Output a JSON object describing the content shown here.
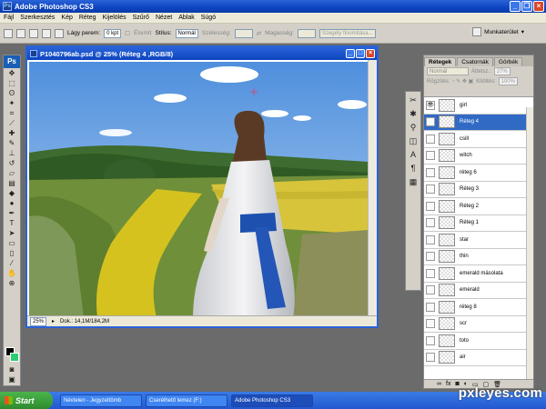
{
  "app": {
    "title": "Adobe Photoshop CS3"
  },
  "menu": [
    "Fájl",
    "Szerkesztés",
    "Kép",
    "Réteg",
    "Kijelölés",
    "Szűrő",
    "Nézet",
    "Ablak",
    "Súgó"
  ],
  "options": {
    "feather_label": "Lágy perem:",
    "feather_value": "0 kpt",
    "antialias_label": "Élsimít",
    "style_label": "Stílus:",
    "style_value": "Normál",
    "width_label": "Szélesség:",
    "height_label": "Magasság:",
    "refine_label": "Szegély finomítása...",
    "workspace_label": "Munkaterület"
  },
  "tools": {
    "logo": "Ps"
  },
  "document": {
    "title": "P1040796ab.psd @ 25% (Réteg 4 ,RGB/8)",
    "zoom": "25%",
    "doc_info": "Dok.: 14,1M/184,2M"
  },
  "layers_panel": {
    "tabs": [
      "Rétegek",
      "Csatornák",
      "Görbék"
    ],
    "blend_mode": "Normál",
    "opacity_label": "Áttetsz.:",
    "opacity_value": "27%",
    "lock_label": "Rögzítés:",
    "fill_label": "Kitöltés:",
    "fill_value": "100%",
    "layers": [
      {
        "name": "girl",
        "visible": true,
        "selected": false
      },
      {
        "name": "Réteg 4",
        "visible": true,
        "selected": true
      },
      {
        "name": "csill",
        "visible": false,
        "selected": false
      },
      {
        "name": "witch",
        "visible": false,
        "selected": false
      },
      {
        "name": "réteg 6",
        "visible": false,
        "selected": false
      },
      {
        "name": "Réteg 3",
        "visible": false,
        "selected": false
      },
      {
        "name": "Réteg 2",
        "visible": false,
        "selected": false
      },
      {
        "name": "Réteg 1",
        "visible": false,
        "selected": false
      },
      {
        "name": "star",
        "visible": false,
        "selected": false
      },
      {
        "name": "thin",
        "visible": false,
        "selected": false
      },
      {
        "name": "emerald másolata",
        "visible": false,
        "selected": false
      },
      {
        "name": "emerald",
        "visible": false,
        "selected": false
      },
      {
        "name": "réteg 8",
        "visible": false,
        "selected": false
      },
      {
        "name": "scr",
        "visible": false,
        "selected": false
      },
      {
        "name": "toto",
        "visible": false,
        "selected": false
      },
      {
        "name": "air",
        "visible": false,
        "selected": false
      }
    ]
  },
  "taskbar": {
    "start": "Start",
    "tasks": [
      "Névtelen - Jegyzettömb",
      "Cserélhető lemez (F:)",
      "Adobe Photoshop CS3"
    ]
  },
  "watermark": "pxleyes.com"
}
